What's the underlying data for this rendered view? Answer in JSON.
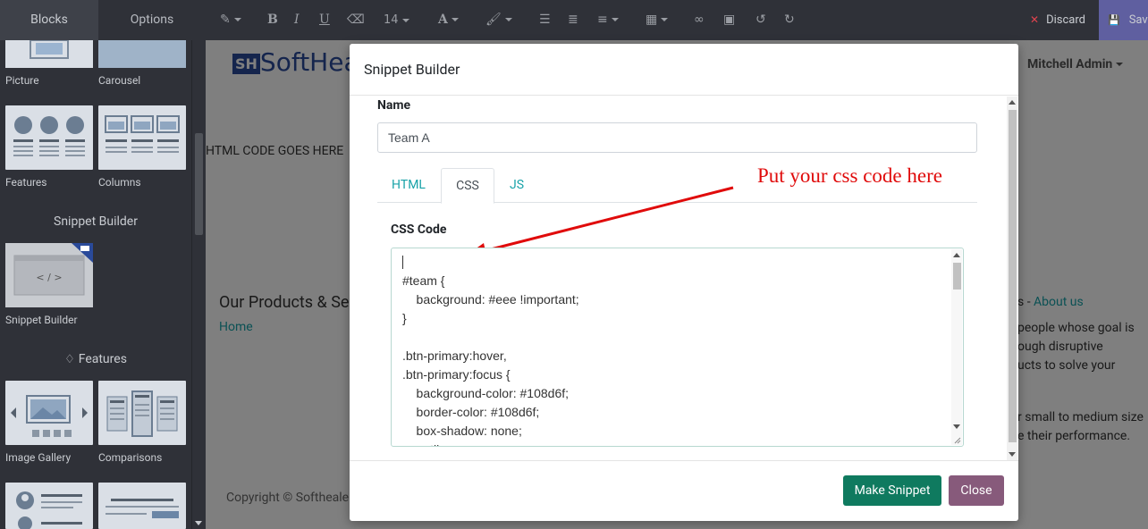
{
  "sidebar": {
    "tabs": [
      "Blocks",
      "Options"
    ],
    "items": [
      {
        "label": "Picture"
      },
      {
        "label": "Carousel"
      },
      {
        "label": "Features"
      },
      {
        "label": "Columns"
      },
      {
        "label": "Snippet Builder"
      },
      {
        "label": "Image Gallery"
      },
      {
        "label": "Comparisons"
      }
    ],
    "sections": {
      "snippet_builder": "Snippet Builder",
      "features": "Features"
    }
  },
  "toolbar": {
    "font_size": "14",
    "discard_label": "Discard",
    "save_label": "Save"
  },
  "page": {
    "logo_text": "SoftHea",
    "user": "Mitchell Admin",
    "html_placeholder": "HTML CODE GOES HERE",
    "products_heading": "Our Products & Ser",
    "home_link": "Home",
    "about_prefix": "s - ",
    "about_link": "About us",
    "about_lines": [
      "people whose goal is",
      "ough disruptive",
      "ucts to solve your"
    ],
    "size_lines": [
      "r small to medium size",
      "e their performance."
    ],
    "copyright": "Copyright © Softheale"
  },
  "modal": {
    "title": "Snippet Builder",
    "name_label": "Name",
    "name_value": "Team A",
    "tabs": [
      "HTML",
      "CSS",
      "JS"
    ],
    "active_tab": "CSS",
    "annotation": "Put your css code here",
    "css_label": "CSS Code",
    "code": "\n#team {\n    background: #eee !important;\n}\n\n.btn-primary:hover,\n.btn-primary:focus {\n    background-color: #108d6f;\n    border-color: #108d6f;\n    box-shadow: none;\n    outline: none;",
    "make_button": "Make Snippet",
    "close_button": "Close"
  },
  "colors": {
    "accent_teal": "#17a2a8",
    "make_button": "#0f7a5f",
    "close_button": "#875a7b",
    "annotation_red": "#e00b0b",
    "save_button": "#5f5fa0"
  }
}
